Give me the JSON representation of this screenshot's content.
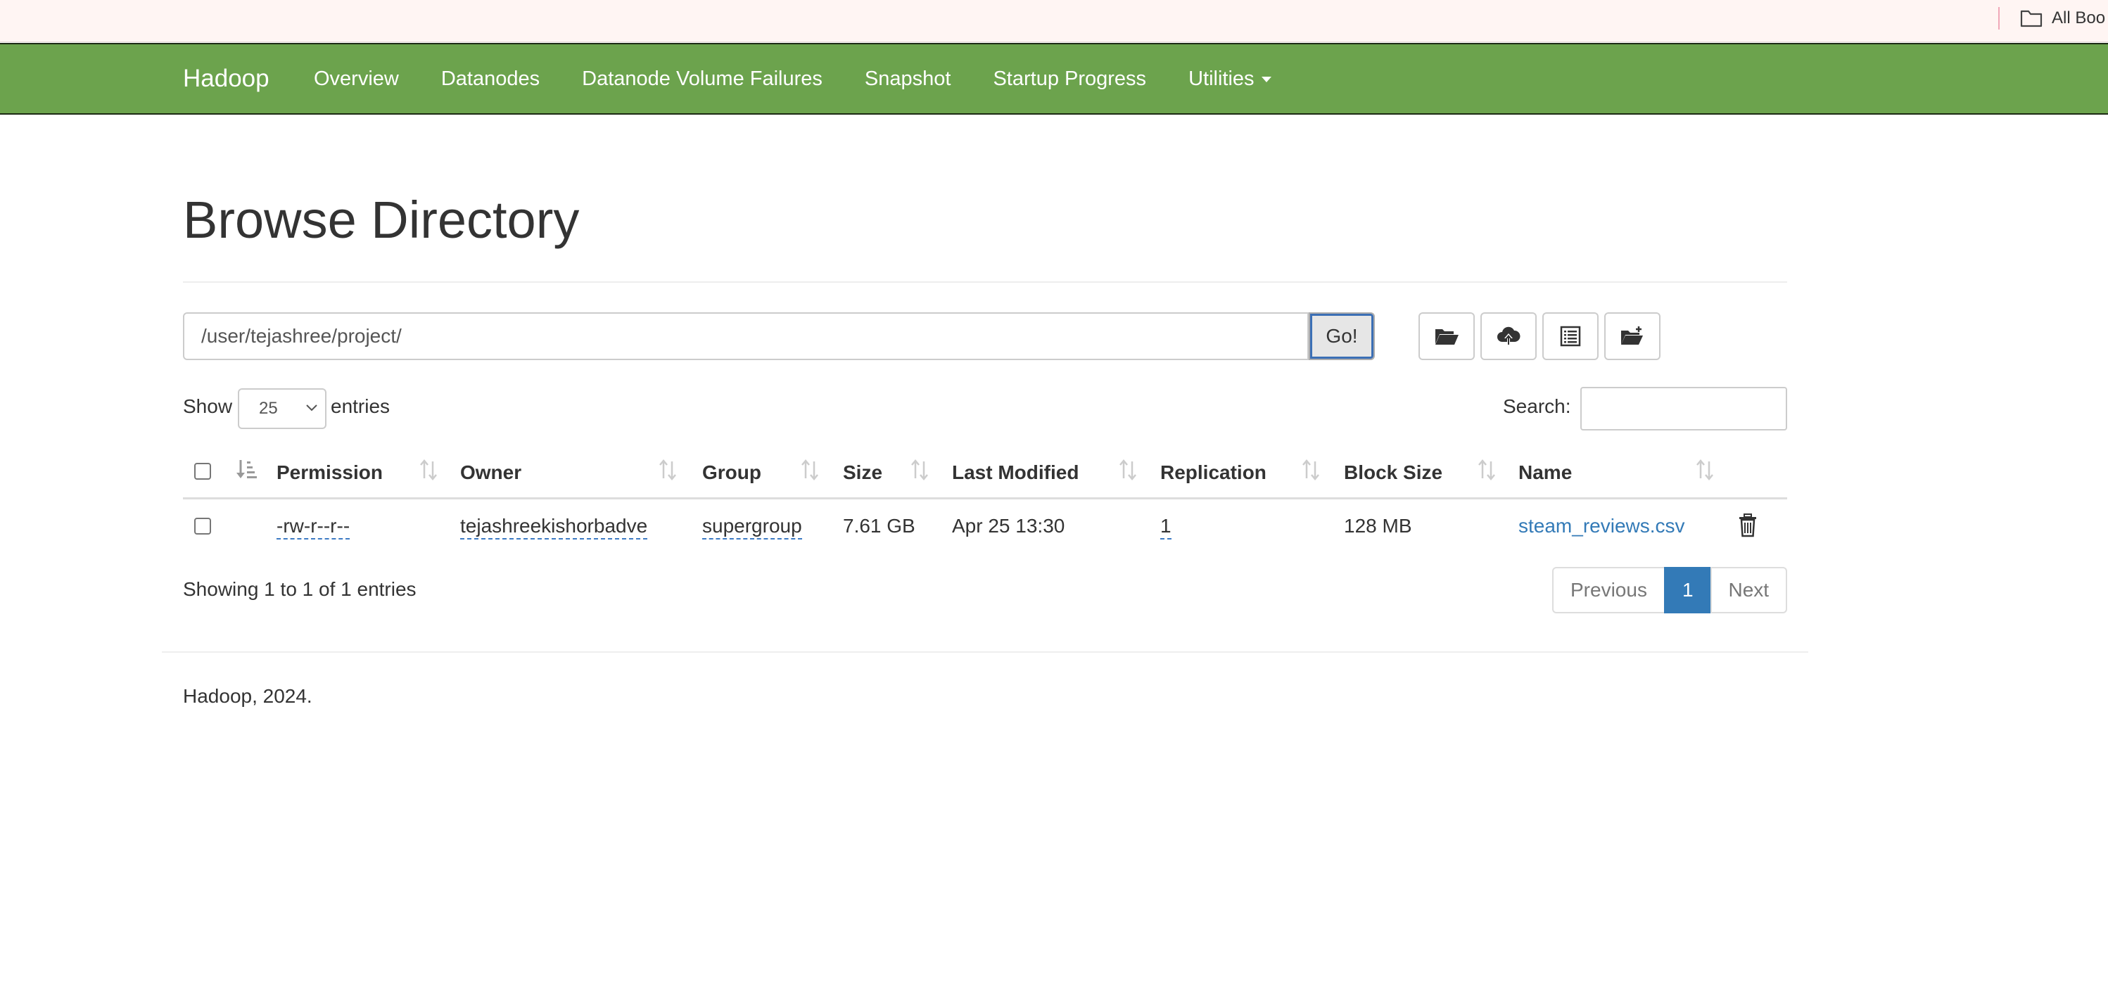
{
  "bookmarks": {
    "all_bookmarks_label": "All Boo"
  },
  "navbar": {
    "brand": "Hadoop",
    "items": [
      "Overview",
      "Datanodes",
      "Datanode Volume Failures",
      "Snapshot",
      "Startup Progress",
      "Utilities"
    ],
    "color": "#6ca34d"
  },
  "page": {
    "title": "Browse Directory"
  },
  "path_bar": {
    "value": "/user/tejashree/project/",
    "go_label": "Go!"
  },
  "toolbar": {
    "icons": [
      "folder-open-icon",
      "cloud-upload-icon",
      "list-icon",
      "folder-plus-icon"
    ]
  },
  "table_controls": {
    "show_label": "Show",
    "entries_value": "25",
    "entries_label": "entries",
    "search_label": "Search:"
  },
  "table": {
    "headers": [
      "Permission",
      "Owner",
      "Group",
      "Size",
      "Last Modified",
      "Replication",
      "Block Size",
      "Name"
    ],
    "rows": [
      {
        "permission": "-rw-r--r--",
        "owner": "tejashreekishorbadve",
        "group": "supergroup",
        "size": "7.61 GB",
        "last_modified": "Apr 25 13:30",
        "replication": "1",
        "block_size": "128 MB",
        "name": "steam_reviews.csv"
      }
    ]
  },
  "pagination": {
    "info": "Showing 1 to 1 of 1 entries",
    "previous": "Previous",
    "current": "1",
    "next": "Next"
  },
  "footer": {
    "text": "Hadoop, 2024."
  }
}
